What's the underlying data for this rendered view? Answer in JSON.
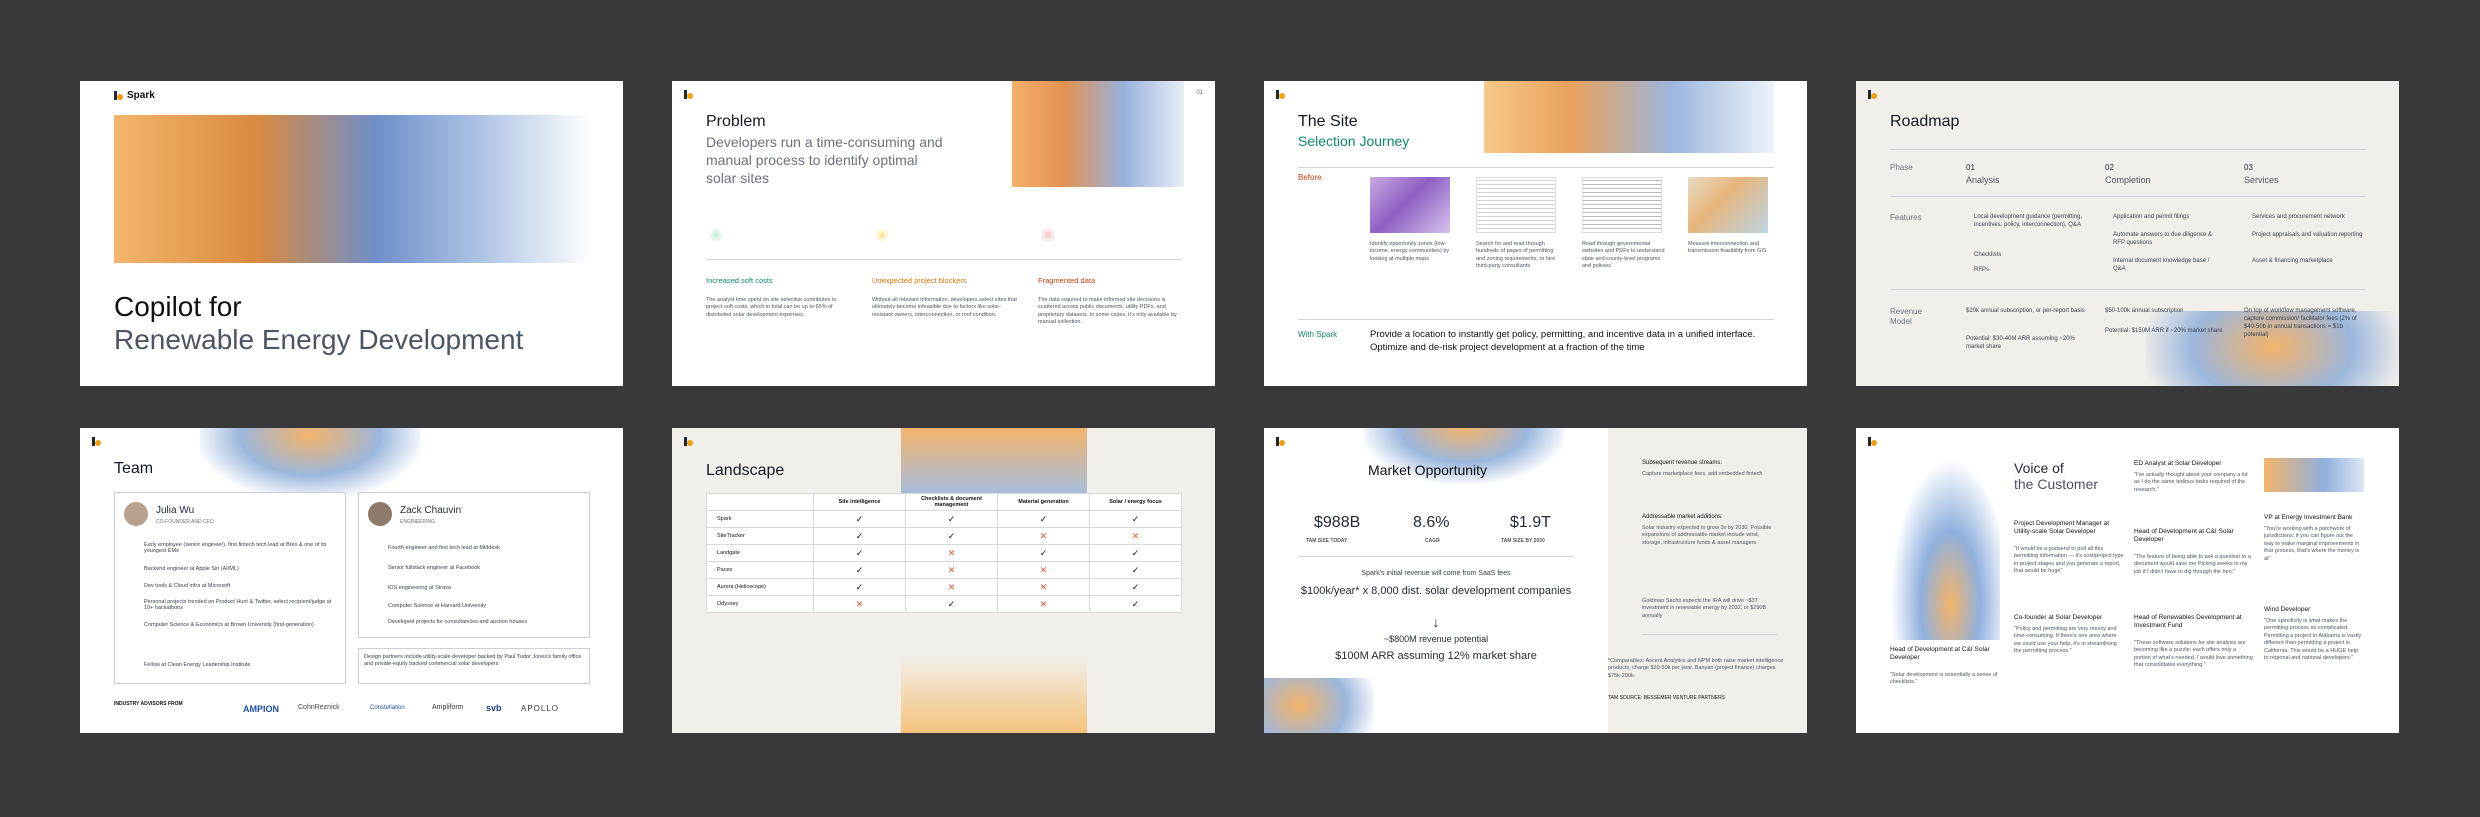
{
  "s1": {
    "brand": "Spark",
    "title1": "Copilot for",
    "title2": "Renewable Energy Development"
  },
  "s2": {
    "title": "Problem",
    "subtitle": "Developers run a time-consuming and manual process to identify optimal solar sites",
    "page": "01",
    "cols": [
      {
        "head": "Increased soft costs",
        "body": "The analyst time spent on site selective contributes to project soft costs, which in total can be up to 65% of distributed solar development expenses."
      },
      {
        "head": "Unexpected project blockers",
        "body": "Without all relevant information, developers select sites that ultimately become infeasible due to factors like solar-resistant owners, interconnection, or roof condition."
      },
      {
        "head": "Fragmented data",
        "body": "The data required to make informed site decisions is scattered across public documents, utility PDFs, and proprietary datasets. In some cases, it's only available by manual collection."
      }
    ]
  },
  "s3": {
    "title": "The Site",
    "subtitle": "Selection Journey",
    "before": "Before",
    "with": "With Spark",
    "steps": [
      "Identify opportunity zones (low-income, energy communities) by looking at multiple maps",
      "Search for and read through hundreds of pages of permitting and zoning requirements, or hire third-party consultants",
      "Read through governmental websites and PDFs to understand state and county-level programs and policies",
      "Measure interconnection and transmission feasibility from GIS"
    ],
    "with_text": "Provide a location to instantly get policy, permitting, and incentive data in a unified interface. Optimize and de-risk project development at a fraction of the time"
  },
  "s4": {
    "title": "Roadmap",
    "phase": "Phase",
    "features": "Features",
    "revenue": "Revenue Model",
    "phases": [
      {
        "num": "01",
        "name": "Analysis"
      },
      {
        "num": "02",
        "name": "Completion"
      },
      {
        "num": "03",
        "name": "Services"
      }
    ],
    "feat": [
      [
        "Local development guidance (permitting, incentives, policy, interconnection), Q&A",
        "Checklists",
        "RFPs"
      ],
      [
        "Application and permit filings",
        "Automate answers to due diligence & RFP questions",
        "Internal document knowledge base / Q&A"
      ],
      [
        "Services and procurement network",
        "Project appraisals and valuation reporting",
        "Asset & financing marketplace"
      ]
    ],
    "rev": [
      [
        "$20k annual subscription, or per-report basis",
        "Potential: $30-40M ARR assuming ~20% market share"
      ],
      [
        "$50-100k annual subscription",
        "Potential: $150M ARR if ~20% market share"
      ],
      [
        "On top of workflow management software, capture commission/ facilitator fees (2% of $40-50b in annual transactions = $1b potential)"
      ]
    ]
  },
  "s5": {
    "title": "Team",
    "p1": {
      "name": "Julia Wu",
      "role": "CO-FOUNDER AND CEO",
      "lines": [
        "Early employee (senior engineer), first fintech tech lead at Brex & one of its youngest EMs",
        "Backend engineer at Apple Siri (AI/ML)",
        "Dev tools & Cloud infra at Microsoft",
        "Personal projects trended on Product Hunt & Twitter, select recipient/judge at 10+ hackathons",
        "Computer Science & Economics at Brown University (first-generation)",
        "Fellow at Clean Energy Leadership Institute"
      ]
    },
    "p2": {
      "name": "Zack Chauvin",
      "role": "ENGINEERING",
      "lines": [
        "Fourth engineer and first tech lead at Middesk",
        "Senior fullstack engineer at Facebook",
        "iOS engineering at Strava",
        "Computer Science at Harvard University",
        "Developed projects for consultancies and auction houses"
      ],
      "partners": "Design partners include utility-scale developer backed by Paul Tudor Jones's family office and private-equity backed commercial solar developers"
    },
    "advisors": "INDUSTRY ADVISORS FROM",
    "logos": [
      "AMPION",
      "CohnReznick",
      "Constellation",
      "Ampliform",
      "svb",
      "APOLLO"
    ]
  },
  "s6": {
    "title": "Landscape",
    "cols": [
      "Site intelligence",
      "Checklists & document management",
      "Material generation",
      "Solar / energy focus"
    ],
    "rows": [
      {
        "name": "Spark",
        "v": [
          1,
          1,
          1,
          1
        ]
      },
      {
        "name": "SiteTracker",
        "v": [
          1,
          1,
          0,
          0
        ]
      },
      {
        "name": "Landgate",
        "v": [
          1,
          0,
          1,
          1
        ]
      },
      {
        "name": "Paces",
        "v": [
          1,
          0,
          0,
          1
        ]
      },
      {
        "name": "Aurora (Helioscope)",
        "v": [
          1,
          0,
          0,
          1
        ]
      },
      {
        "name": "Odyssey",
        "v": [
          0,
          1,
          0,
          1
        ]
      }
    ]
  },
  "s7": {
    "title": "Market Opportunity",
    "stats": [
      {
        "v": "$988B",
        "l": "TAM SIZE TODAY"
      },
      {
        "v": "8.6%",
        "l": "CAGR"
      },
      {
        "v": "$1.9T",
        "l": "TAM SIZE BY 2030"
      }
    ],
    "l1": "Spark's initial revenue will come from SaaS fees",
    "l2": "$100k/year* x 8,000 dist. solar development companies",
    "arrow": "↓",
    "l3": "~$800M revenue potential",
    "l4": "$100M ARR assuming 12% market share",
    "r1h": "Subsequent revenue streams:",
    "r1": "Capture marketplace fees, add embedded fintech",
    "r2h": "Addressable market additions:",
    "r2": "Solar industry expected to grow 3x by 2030. Possible expansions of addressable market include wind, storage, infrastructure funds & asset managers",
    "r3": "Goldman Sachs expects the IRA will drive ~$3T investment in renewable energy by 2032, or $290B annually",
    "r4": "*Comparables: Ascent Analytics and NPM both raise market intelligence products; charge $20-50k per year. Banyan (project finance) charges $75k-200k.",
    "src": "TAM SOURCE: BESSEMER VENTURE PARTNERS"
  },
  "s8": {
    "title1": "Voice of",
    "title2": "the Customer",
    "quotes": [
      {
        "who": "Head of Development at C&I Solar Developer",
        "q": "\"Solar development is essentially a series of checklists.\""
      },
      {
        "who": "Project Development Manager at Utility-scale Solar Developer",
        "q": "\"It would be a godsend to pull all this permitting information — it's cost/project type in project stages and you generate a report, that would be huge\""
      },
      {
        "who": "Co-founder at Solar Developer",
        "q": "\"Policy and permitting are very messy and time-consuming. If there's one area where we could use your help, it's in streamlining the permitting process.\""
      },
      {
        "who": "ED Analyst at Solar Developer",
        "q": "\"I've actually thought about your company a lot as I do the same tedious tasks required of the research.\""
      },
      {
        "who": "Head of Development at C&I Solar Developer",
        "q": "\"The feature of being able to ask a question to a document would save me Picking weeks in my job if I didn't have to dig through the hen.\""
      },
      {
        "who": "Head of Renewables Development at Investment Fund",
        "q": "\"These software solutions for site analysis are becoming like a puzzle; each offers only a portion of what's needed. I would love something that consolidates everything.\""
      },
      {
        "who": "VP at Energy Investment Bank",
        "q": "\"You're working with a patchwork of jurisdictions; if you can figure out the way to make marginal improvements in that process, that's where the money is at\""
      },
      {
        "who": "Wind Developer",
        "q": "\"One specificity is what makes the permitting process so complicated. Permitting a project in Alabama is vastly different than permitting a project in California. This would be a HUGE help to regional and national developers.\""
      }
    ]
  }
}
